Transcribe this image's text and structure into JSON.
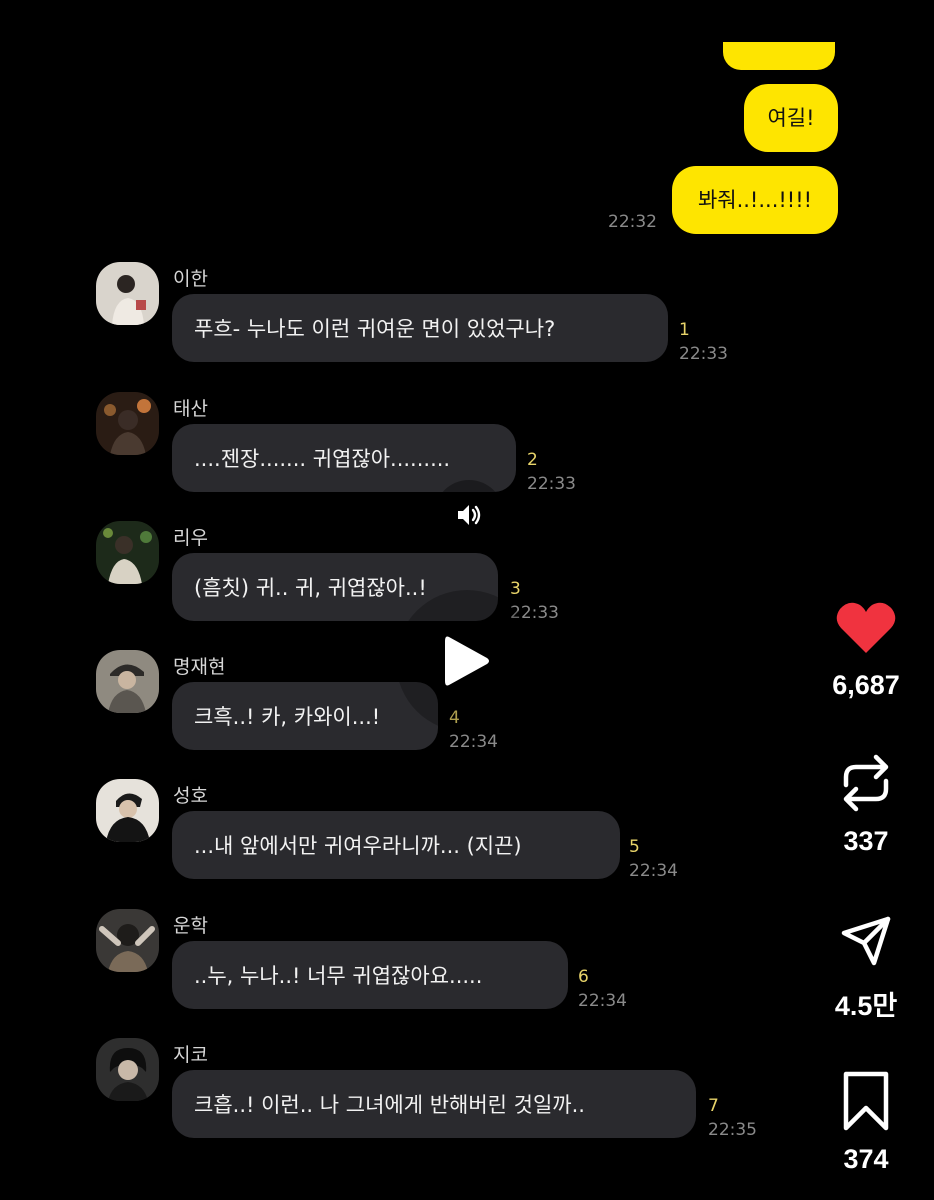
{
  "my_messages": [
    {
      "text": ""
    },
    {
      "text": "여길!"
    },
    {
      "text": "봐줘..!...!!!!"
    }
  ],
  "my_time": "22:32",
  "messages": [
    {
      "sender": "이한",
      "text": "푸흐- 누나도 이런 귀여운 면이 있었구나?",
      "unread": "1",
      "time": "22:33"
    },
    {
      "sender": "태산",
      "text": "....젠장....... 귀엽잖아.........",
      "unread": "2",
      "time": "22:33"
    },
    {
      "sender": "리우",
      "text": "(흠칫) 귀.. 귀, 귀엽잖아..!",
      "unread": "3",
      "time": "22:33"
    },
    {
      "sender": "명재현",
      "text": "크흑..! 카, 카와이...!",
      "unread": "4",
      "time": "22:34"
    },
    {
      "sender": "성호",
      "text": "...내 앞에서만 귀여우라니까... (지끈)",
      "unread": "5",
      "time": "22:34"
    },
    {
      "sender": "운학",
      "text": "..누, 누나..! 너무 귀엽잖아요.....",
      "unread": "6",
      "time": "22:34"
    },
    {
      "sender": "지코",
      "text": "크흡..! 이런.. 나 그녀에게 반해버린 것일까..",
      "unread": "7",
      "time": "22:35"
    }
  ],
  "actions": {
    "like": {
      "icon": "heart-icon",
      "count": "6,687",
      "color": "#f0333f"
    },
    "repost": {
      "icon": "repost-icon",
      "count": "337"
    },
    "share": {
      "icon": "send-icon",
      "count": "4.5만"
    },
    "save": {
      "icon": "bookmark-icon",
      "count": "374"
    }
  },
  "colors": {
    "background": "#000000",
    "my_bubble": "#fee500",
    "other_bubble": "#2a2a2e",
    "unread": "#e8d46a",
    "time": "#8a8a8a"
  }
}
